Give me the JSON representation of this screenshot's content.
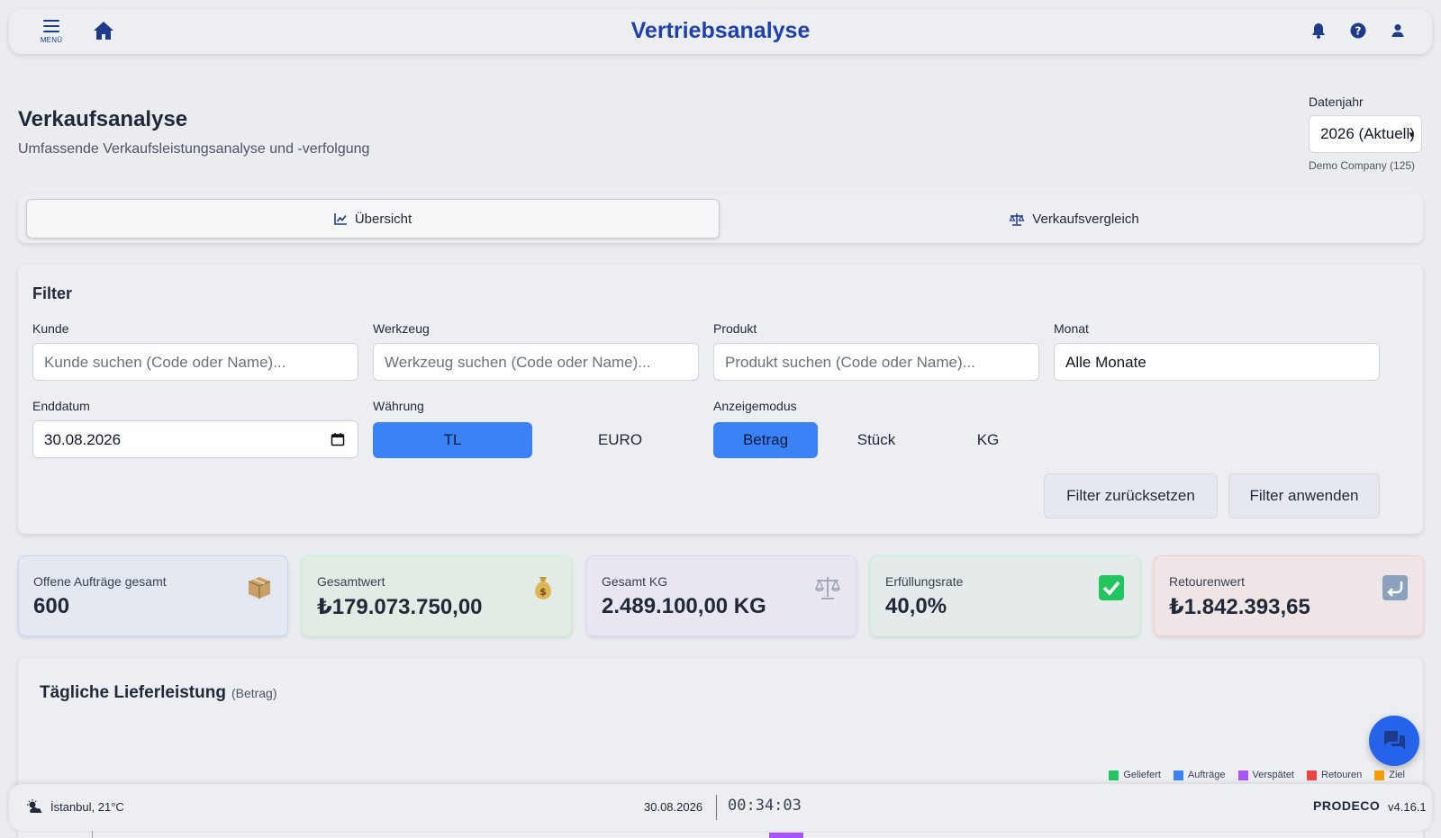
{
  "topbar": {
    "menu_label": "MENÜ",
    "app_title": "Vertriebsanalyse",
    "icons": [
      "menu-icon",
      "home-icon",
      "bell-icon",
      "help-icon",
      "user-icon"
    ]
  },
  "header": {
    "title": "Verkaufsanalyse",
    "subtitle": "Umfassende Verkaufsleistungsanalyse und -verfolgung",
    "year_label": "Datenjahr",
    "year_value": "2026 (Aktuell)",
    "company": "Demo Company (125)"
  },
  "tabs": [
    {
      "label": "Übersicht",
      "icon": "line-chart-icon",
      "active": true
    },
    {
      "label": "Verkaufsvergleich",
      "icon": "scale-icon",
      "active": false
    }
  ],
  "filter": {
    "title": "Filter",
    "customer": {
      "label": "Kunde",
      "placeholder": "Kunde suchen (Code oder Name)..."
    },
    "tool": {
      "label": "Werkzeug",
      "placeholder": "Werkzeug suchen (Code oder Name)..."
    },
    "product": {
      "label": "Produkt",
      "placeholder": "Produkt suchen (Code oder Name)..."
    },
    "month": {
      "label": "Monat",
      "value": "Alle Monate"
    },
    "end_date": {
      "label": "Enddatum",
      "value": "30.08.2026"
    },
    "currency": {
      "label": "Währung",
      "options": [
        "TL",
        "EURO"
      ],
      "selected": "TL"
    },
    "display_mode": {
      "label": "Anzeigemodus",
      "options": [
        "Betrag",
        "Stück",
        "KG"
      ],
      "selected": "Betrag"
    },
    "reset_label": "Filter zurücksetzen",
    "apply_label": "Filter anwenden"
  },
  "kpis": [
    {
      "label": "Offene Aufträge gesamt",
      "value": "600",
      "icon": "package-icon"
    },
    {
      "label": "Gesamtwert",
      "value": "₺179.073.750,00",
      "icon": "money-bag-icon"
    },
    {
      "label": "Gesamt KG",
      "value": "2.489.100,00 KG",
      "icon": "balance-scale-icon"
    },
    {
      "label": "Erfüllungsrate",
      "value": "40,0%",
      "icon": "check-mark-icon"
    },
    {
      "label": "Retourenwert",
      "value": "₺1.842.393,65",
      "icon": "return-arrow-icon"
    }
  ],
  "chart": {
    "title": "Tägliche Lieferleistung",
    "subtitle": "(Betrag)",
    "legend": [
      {
        "name": "Geliefert",
        "color": "#22c55e"
      },
      {
        "name": "Aufträge",
        "color": "#3b82f6"
      },
      {
        "name": "Verspätet",
        "color": "#a855f7"
      },
      {
        "name": "Retouren",
        "color": "#ef4444"
      },
      {
        "name": "Ziel",
        "color": "#f59e0b"
      }
    ]
  },
  "statusbar": {
    "weather": "İstanbul, 21°C",
    "date": "30.08.2026",
    "clock": "00:34:03",
    "brand": "PRODECO",
    "version": "v4.16.1"
  },
  "colors": {
    "accent": "#1e40af",
    "primary_button": "#3b82f6",
    "fab": "#2563eb"
  }
}
